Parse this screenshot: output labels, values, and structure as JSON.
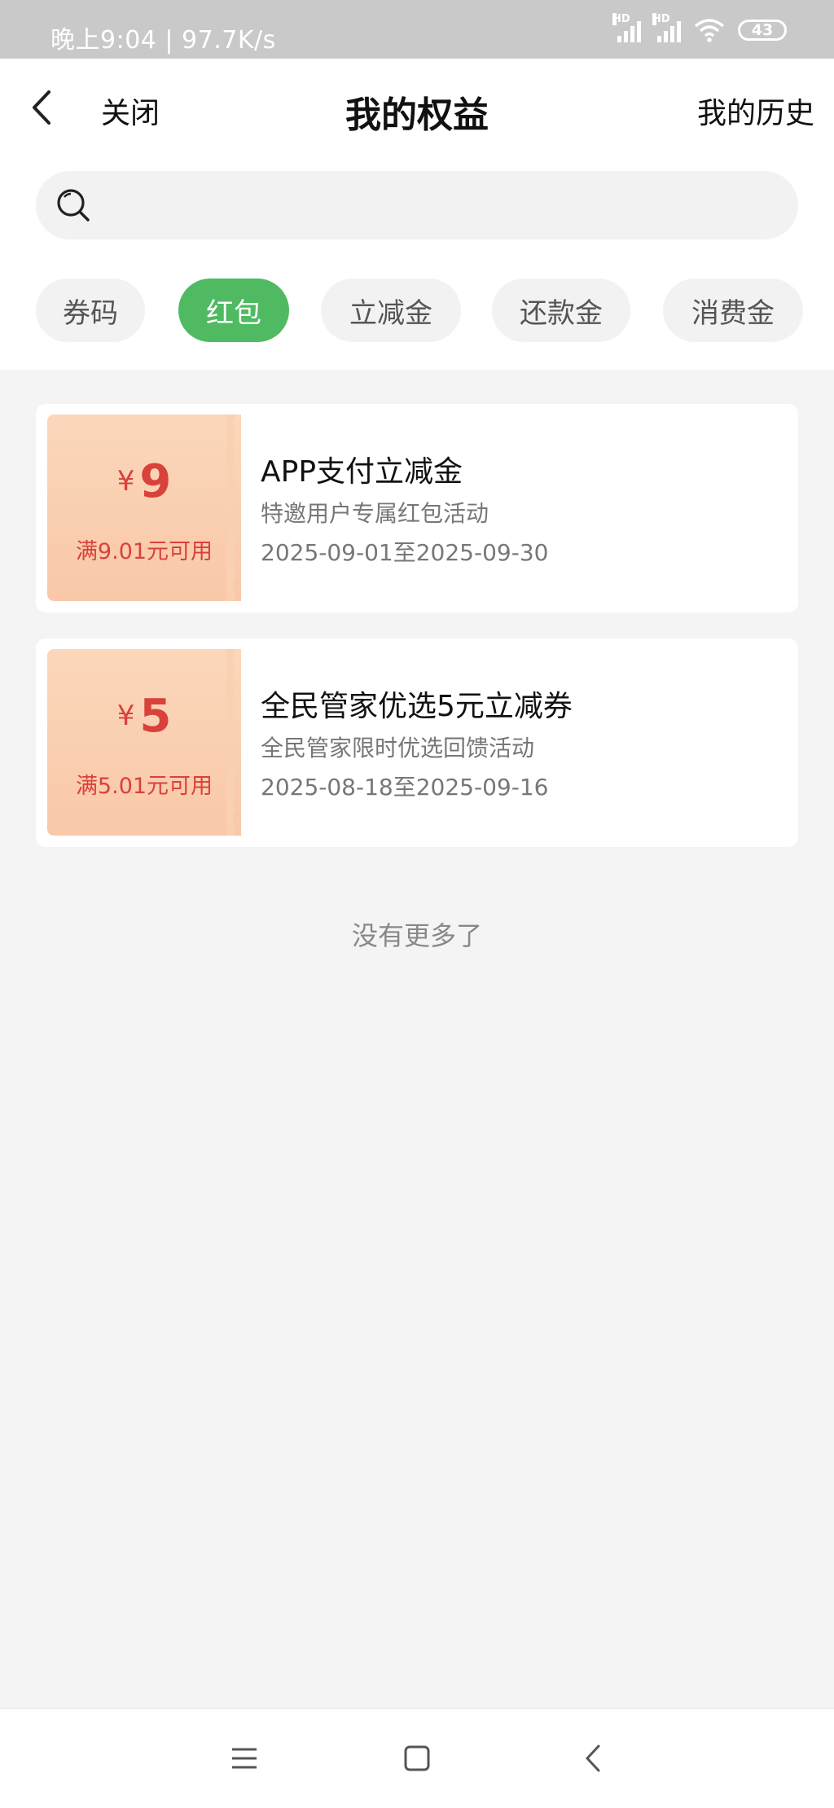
{
  "status_bar": {
    "time_speed": "晚上9:04 | 97.7K/s",
    "hd1": "HD",
    "hd2": "HD",
    "battery": "43",
    "icons": [
      "signal-hd-icon",
      "signal-hd-icon",
      "wifi-icon",
      "battery-icon"
    ]
  },
  "header": {
    "back_icon": "chevron-left-icon",
    "close_label": "关闭",
    "title": "我的权益",
    "history_label": "我的历史"
  },
  "search": {
    "icon": "search-icon",
    "placeholder": ""
  },
  "tabs": [
    {
      "label": "券码",
      "active": false
    },
    {
      "label": "红包",
      "active": true
    },
    {
      "label": "立减金",
      "active": false
    },
    {
      "label": "还款金",
      "active": false
    },
    {
      "label": "消费金",
      "active": false
    }
  ],
  "colors": {
    "accent_green": "#4fba61",
    "price_red": "#d9413b",
    "stub_bg": "#fbd7bb"
  },
  "coupons": [
    {
      "currency": "¥",
      "amount": "9",
      "condition": "满9.01元可用",
      "title": "APP支付立减金",
      "subtitle": "特邀用户专属红包活动",
      "validity": "2025-09-01至2025-09-30"
    },
    {
      "currency": "¥",
      "amount": "5",
      "condition": "满5.01元可用",
      "title": "全民管家优选5元立减券",
      "subtitle": "全民管家限时优选回馈活动",
      "validity": "2025-08-18至2025-09-16"
    }
  ],
  "footer_text": "没有更多了",
  "nav": {
    "icons": [
      "menu-icon",
      "home-square-icon",
      "back-triangle-icon"
    ]
  }
}
